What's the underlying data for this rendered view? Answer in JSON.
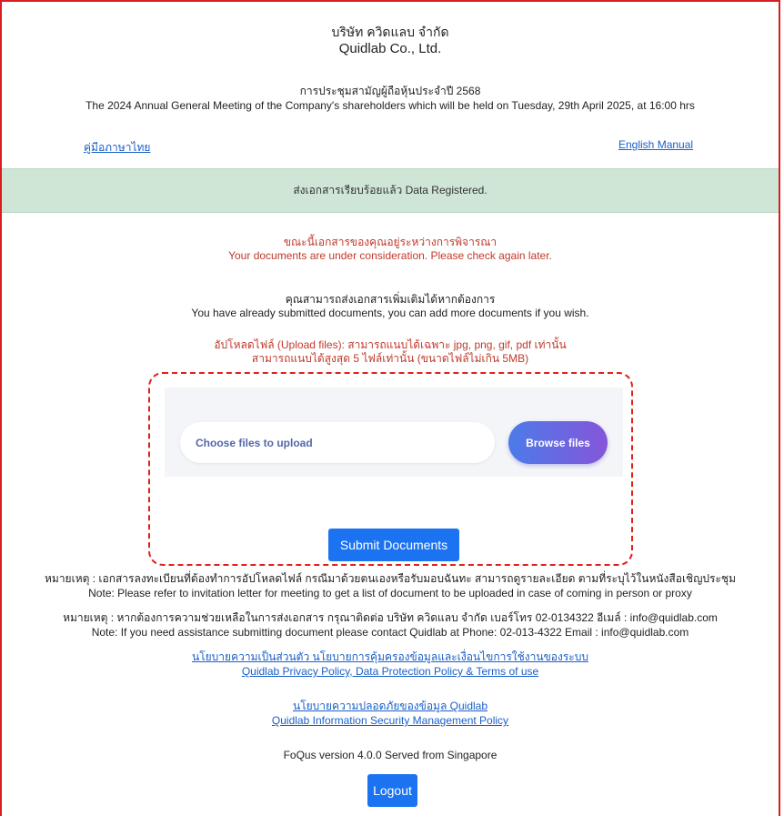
{
  "header": {
    "company_th": "บริษัท ควิดแลบ จำกัด",
    "company_en": "Quidlab Co., Ltd."
  },
  "meeting": {
    "title_th": "การประชุมสามัญผู้ถือหุ้นประจำปี 2568",
    "title_en": "The 2024 Annual General Meeting of the Company's shareholders which will be held on Tuesday, 29th April 2025, at 16:00 hrs"
  },
  "manuals": {
    "thai": "คู่มือภาษาไทย",
    "english": "English Manual"
  },
  "status_banner": "ส่งเอกสารเรียบร้อยแล้ว Data Registered.",
  "consideration": {
    "th": "ขณะนี้เอกสารของคุณอยู่ระหว่างการพิจารณา",
    "en": "Your documents are under consideration. Please check again later."
  },
  "already_submitted": {
    "th": "คุณสามารถส่งเอกสารเพิ่มเติมได้หากต้องการ",
    "en": "You have already submitted documents, you can add more documents if you wish."
  },
  "upload_note": {
    "line1": "อัปโหลดไฟล์ (Upload files): สามารถแนบได้เฉพาะ jpg, png, gif, pdf เท่านั้น",
    "line2": "สามารถแนบได้สูงสุด 5 ไฟล์เท่านั้น (ขนาดไฟล์ไม่เกิน 5MB)"
  },
  "upload": {
    "placeholder": "Choose files to upload",
    "browse_label": "Browse files",
    "submit_label": "Submit Documents"
  },
  "notes": {
    "note1_th": "หมายเหตุ : เอกสารลงทะเบียนที่ต้องทำการอัปโหลดไฟล์ กรณีมาด้วยตนเองหรือรับมอบฉันทะ สามารถดูรายละเอียด ตามที่ระบุไว้ในหนังสือเชิญประชุม",
    "note1_en": "Note: Please refer to invitation letter for meeting to get a list of document to be uploaded in case of coming in person or proxy",
    "note2_th": "หมายเหตุ : หากต้องการความช่วยเหลือในการส่งเอกสาร กรุณาติดต่อ บริษัท ควิดแลบ จำกัด เบอร์โทร 02-0134322 อีเมล์ : info@quidlab.com",
    "note2_en": "Note: If you need assistance submitting document please contact Quidlab at Phone: 02-013-4322 Email : info@quidlab.com"
  },
  "policies": {
    "privacy_th": "นโยบายความเป็นส่วนตัว นโยบายการคุ้มครองข้อมูลและเงื่อนไขการใช้งานของระบบ",
    "privacy_en": "Quidlab Privacy Policy, Data Protection Policy & Terms of use",
    "security_th": "นโยบายความปลอดภัยของข้อมูล Quidlab",
    "security_en": "Quidlab Information Security Management Policy"
  },
  "footer": {
    "version": "FoQus version 4.0.0 Served from Singapore",
    "logout_label": "Logout"
  }
}
